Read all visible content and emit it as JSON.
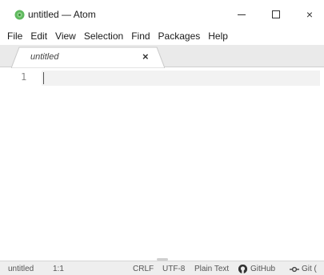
{
  "window": {
    "title": "untitled — Atom",
    "controls": {
      "minimize": "minimize",
      "maximize": "maximize",
      "close": "×"
    }
  },
  "menu": {
    "items": [
      "File",
      "Edit",
      "View",
      "Selection",
      "Find",
      "Packages",
      "Help"
    ]
  },
  "tabs": [
    {
      "label": "untitled",
      "close": "×"
    }
  ],
  "editor": {
    "line_numbers": [
      "1"
    ]
  },
  "status": {
    "file": "untitled",
    "position": "1:1",
    "line_ending": "CRLF",
    "encoding": "UTF-8",
    "grammar": "Plain Text",
    "github": "GitHub",
    "git": "Git (",
    "icons": {
      "github": "github-icon",
      "git": "git-commit-icon"
    }
  },
  "colors": {
    "app_icon": "#5fb95e",
    "tab_bar": "#eaeaea",
    "cursor_line": "#f2f2f2",
    "status_bar": "#eeeeee"
  }
}
